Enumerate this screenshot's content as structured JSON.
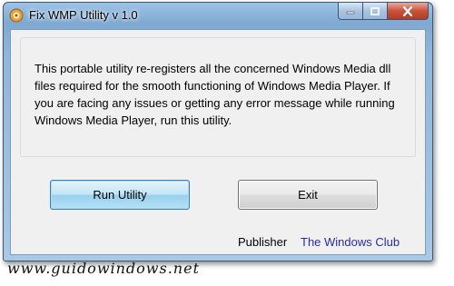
{
  "window": {
    "title": "Fix WMP Utility v 1.0",
    "caption_buttons": [
      "minimize",
      "maximize",
      "close"
    ]
  },
  "message": "This portable utility re-registers all the concerned Windows Media dll files required for the smooth functioning of Windows Media Player. If you are facing any issues or getting any error message while running Windows Media Player, run this utility.",
  "buttons": {
    "run_label": "Run Utility",
    "exit_label": "Exit"
  },
  "publisher": {
    "label": "Publisher",
    "link_text": "The Windows Club"
  },
  "watermark": "www.guidowindows.net",
  "colors": {
    "link": "#2a2aa8",
    "close_button": "#c9523a",
    "frame": "#8fb6db"
  }
}
